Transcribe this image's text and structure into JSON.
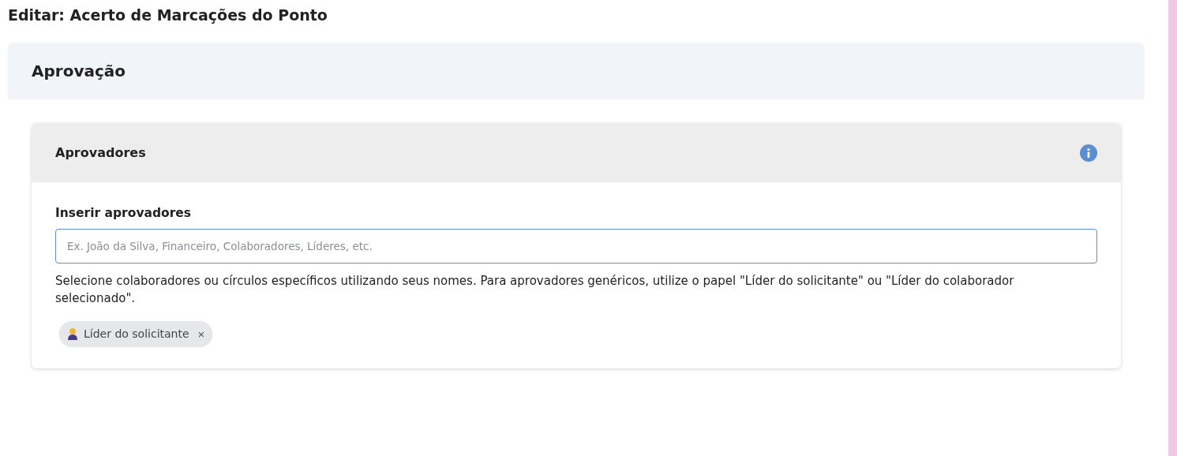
{
  "page_title": "Editar: Acerto de Marcações do Ponto",
  "section": {
    "title": "Aprovação"
  },
  "card": {
    "title": "Aprovadores",
    "field": {
      "label": "Inserir aprovadores",
      "placeholder": "Ex. João da Silva, Financeiro, Colaboradores, Líderes, etc."
    },
    "help": "Selecione colaboradores ou círculos específicos utilizando seus nomes. Para aprovadores genéricos, utilize o papel \"Líder do solicitante\" ou \"Líder do colaborador selecionado\".",
    "chips": [
      {
        "label": "Líder do solicitante",
        "remove": "×"
      }
    ]
  }
}
